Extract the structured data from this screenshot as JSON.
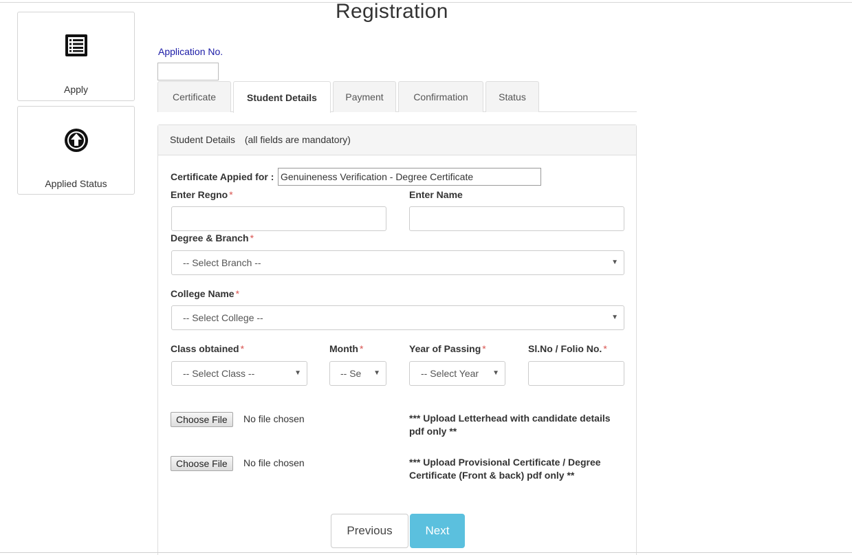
{
  "page": {
    "title": "Registration"
  },
  "sidebar": {
    "items": [
      {
        "label": "Apply",
        "icon": "list-icon"
      },
      {
        "label": "Applied Status",
        "icon": "upload-circle-icon"
      }
    ]
  },
  "application": {
    "label": "Application No.",
    "value": ""
  },
  "tabs": [
    {
      "label": "Certificate",
      "active": false
    },
    {
      "label": "Student Details",
      "active": true
    },
    {
      "label": "Payment",
      "active": false
    },
    {
      "label": "Confirmation",
      "active": false
    },
    {
      "label": "Status",
      "active": false
    }
  ],
  "panel": {
    "heading": "Student Details",
    "note": "(all fields are mandatory)"
  },
  "form": {
    "certificate": {
      "label": "Certificate Appied for :",
      "value": "Genuineness Verification - Degree Certificate"
    },
    "regno": {
      "label": "Enter Regno",
      "required_mark": "*",
      "value": ""
    },
    "name": {
      "label": "Enter Name",
      "value": ""
    },
    "degree": {
      "label": "Degree & Branch",
      "required_mark": "*",
      "selected": "-- Select Branch --"
    },
    "college": {
      "label": "College Name",
      "required_mark": "*",
      "selected": "-- Select College --"
    },
    "class_obtained": {
      "label": "Class obtained",
      "required_mark": "*",
      "selected": "-- Select Class --"
    },
    "month": {
      "label": "Month",
      "required_mark": "*",
      "selected": "-- Se"
    },
    "year": {
      "label": "Year of Passing",
      "required_mark": "*",
      "selected": "-- Select Year"
    },
    "folio": {
      "label": "Sl.No / Folio No.",
      "required_mark": "*",
      "value": ""
    },
    "upload1": {
      "button": "Choose File",
      "status": "No file chosen",
      "note_line1": "*** Upload Letterhead with candidate details",
      "note_line2": "pdf only **"
    },
    "upload2": {
      "button": "Choose File",
      "status": "No file chosen",
      "note_line1": "*** Upload Provisional Certificate / Degree",
      "note_line2": "Certificate (Front & back) pdf only **"
    }
  },
  "buttons": {
    "previous": "Previous",
    "next": "Next"
  },
  "colors": {
    "accent": "#5bc0de",
    "required": "#d9534f",
    "app_label": "#1a1aa6"
  }
}
